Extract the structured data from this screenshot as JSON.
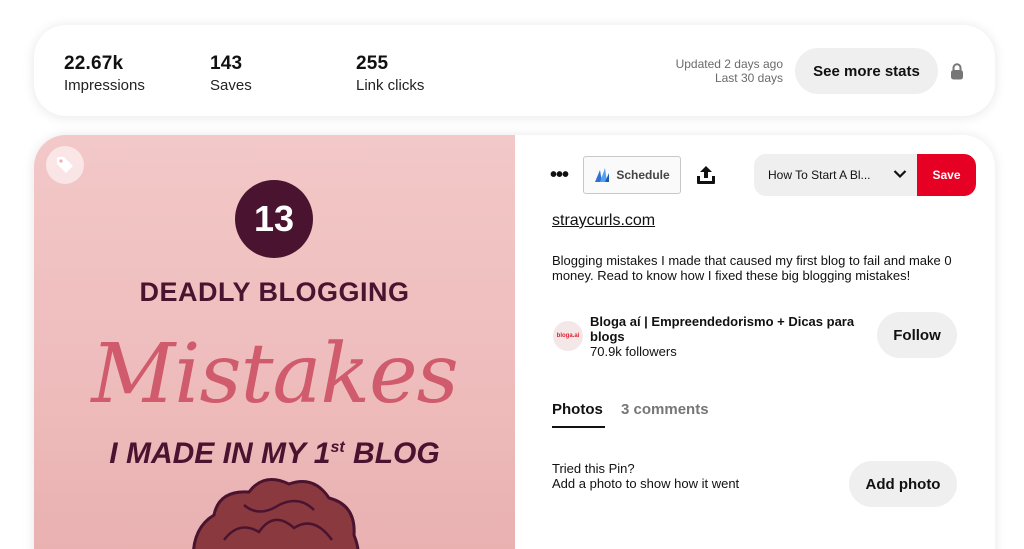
{
  "stats": {
    "impressions": {
      "value": "22.67k",
      "label": "Impressions"
    },
    "saves": {
      "value": "143",
      "label": "Saves"
    },
    "link_clicks": {
      "value": "255",
      "label": "Link clicks"
    },
    "updated": "Updated 2 days ago",
    "period": "Last 30 days",
    "see_more_label": "See more stats",
    "lock_icon": "lock-icon"
  },
  "pin_image": {
    "number": "13",
    "line1": "DEADLY BLOGGING",
    "line2": "Mistakes",
    "line3": "I MADE IN MY 1",
    "line3_sup": "st",
    "line3_end": " BLOG",
    "tag_icon": "tag-icon",
    "colors": {
      "background": "#f0c2c2",
      "dark": "#4a1430",
      "accent": "#cf5b6d"
    }
  },
  "actions": {
    "more_icon": "more-dots-icon",
    "schedule_label": "Schedule",
    "share_icon": "share-icon",
    "board_name": "How To Start A Bl...",
    "save_label": "Save",
    "save_color": "#e60023"
  },
  "pin": {
    "link": "straycurls.com",
    "description": "Blogging mistakes I made that caused my first blog to fail and make 0 money. Read to know how I fixed these big blogging mistakes!"
  },
  "creator": {
    "avatar_text": "bloga.ai",
    "name": "Bloga aí | Empreendedorismo + Dicas para blogs",
    "followers": "70.9k followers",
    "follow_label": "Follow"
  },
  "tabs": [
    {
      "label": "Photos",
      "active": true
    },
    {
      "label": "3 comments",
      "active": false
    }
  ],
  "photos": {
    "line1": "Tried this Pin?",
    "line2": "Add a photo to show how it went",
    "add_label": "Add photo"
  }
}
